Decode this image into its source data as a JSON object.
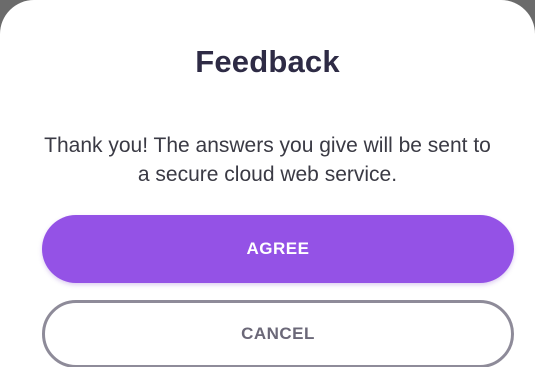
{
  "dialog": {
    "title": "Feedback",
    "message": "Thank you! The answers you give will be sent to a secure cloud web service.",
    "agree_label": "AGREE",
    "cancel_label": "CANCEL"
  },
  "colors": {
    "accent": "#9452e6",
    "title_text": "#2e2b45",
    "cancel_border": "#8e8b99"
  }
}
